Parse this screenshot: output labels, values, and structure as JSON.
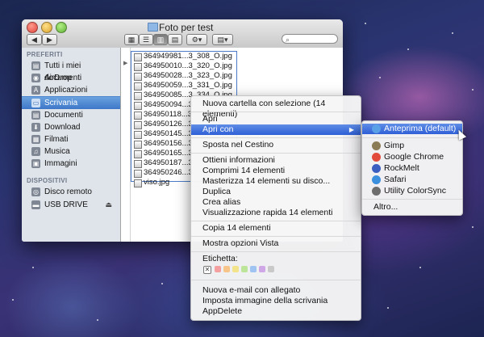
{
  "window": {
    "title": "Foto per test"
  },
  "toolbar": {
    "back_glyph": "◀",
    "forward_glyph": "▶",
    "view_icons": [
      "icon-view-icon",
      "list-view-icon",
      "column-view-icon",
      "coverflow-view-icon"
    ],
    "view_glyphs": [
      "▦",
      "☰",
      "▥",
      "▤"
    ],
    "active_view": 2,
    "action_glyph": "⚙▾",
    "arrange_glyph": "▤▾",
    "search_glyph": "⌕"
  },
  "sidebar": {
    "favorites_header": "PREFERITI",
    "favorites": [
      {
        "label": "Tutti i miei documenti",
        "icon": "all-documents-icon",
        "glyph": "▤"
      },
      {
        "label": "AirDrop",
        "icon": "airdrop-icon",
        "glyph": "◉"
      },
      {
        "label": "Applicazioni",
        "icon": "applications-icon",
        "glyph": "A"
      },
      {
        "label": "Scrivania",
        "icon": "desktop-icon",
        "glyph": "▭",
        "selected": true
      },
      {
        "label": "Documenti",
        "icon": "documents-icon",
        "glyph": "▤"
      },
      {
        "label": "Download",
        "icon": "download-icon",
        "glyph": "⬇"
      },
      {
        "label": "Filmati",
        "icon": "movies-icon",
        "glyph": "▦"
      },
      {
        "label": "Musica",
        "icon": "music-icon",
        "glyph": "♫"
      },
      {
        "label": "Immagini",
        "icon": "pictures-icon",
        "glyph": "▣"
      }
    ],
    "devices_header": "DISPOSITIVI",
    "devices": [
      {
        "label": "Disco remoto",
        "icon": "remote-disc-icon",
        "glyph": "◎"
      },
      {
        "label": "USB DRIVE",
        "icon": "usb-drive-icon",
        "glyph": "▬",
        "eject": "⏏"
      }
    ]
  },
  "files": [
    "364949981...3_308_O.jpg",
    "364950010...3_320_O.jpg",
    "364950028...3_323_O.jpg",
    "364950059...3_331_O.jpg",
    "364950085...3_334_O.jpg",
    "364950094...3",
    "364950118...3",
    "364950126...3",
    "364950145...3",
    "364950156...3",
    "364950165...3",
    "364950187...3",
    "364950246...3",
    "viso.jpg"
  ],
  "context_menu": {
    "groups": [
      [
        "Nuova cartella con selezione (14 elementi)"
      ],
      [
        "Apri",
        "Apri con"
      ],
      [
        "Sposta nel Cestino"
      ],
      [
        "Ottieni informazioni",
        "Comprimi 14 elementi",
        "Masterizza 14 elementi su disco...",
        "Duplica",
        "Crea alias",
        "Visualizzazione rapida 14 elementi"
      ],
      [
        "Copia 14 elementi"
      ],
      [
        "Mostra opzioni Vista"
      ],
      [
        "Etichetta:"
      ],
      [
        "Nuova e-mail con allegato",
        "Imposta immagine della scrivania",
        "AppDelete"
      ]
    ],
    "highlighted": "Apri con",
    "submenu_arrow": "▶",
    "label_clear_glyph": "✕",
    "label_colors": [
      "#f5a0a0",
      "#f7c58a",
      "#f3e38a",
      "#bde59a",
      "#9fc4f2",
      "#cfa7e6",
      "#c9c9c9"
    ]
  },
  "submenu": {
    "items": [
      {
        "label": "Anteprima (default)",
        "icon": "preview-icon",
        "color": "#5aa0e6",
        "highlighted": true
      },
      {
        "label": "Gimp",
        "icon": "gimp-icon",
        "color": "#8b7b56"
      },
      {
        "label": "Google Chrome",
        "icon": "chrome-icon",
        "color": "#e24a3b"
      },
      {
        "label": "RockMelt",
        "icon": "rockmelt-icon",
        "color": "#3b5fc0"
      },
      {
        "label": "Safari",
        "icon": "safari-icon",
        "color": "#3c8fdc"
      },
      {
        "label": "Utility ColorSync",
        "icon": "colorsync-icon",
        "color": "#6d6d6d"
      }
    ],
    "other": "Altro..."
  }
}
